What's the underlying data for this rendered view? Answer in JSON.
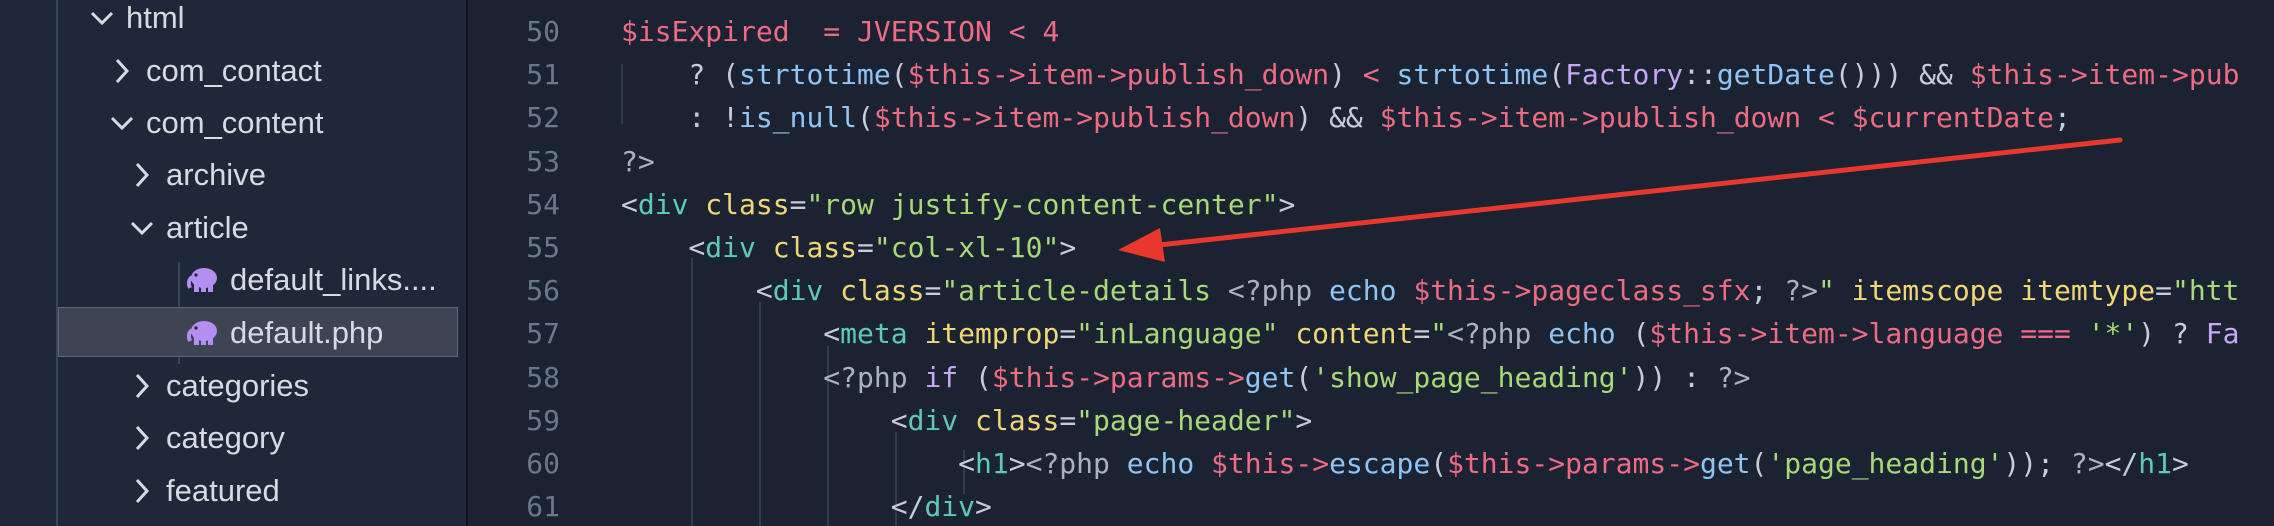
{
  "explorer": {
    "items": [
      {
        "label": "html",
        "state": "expanded",
        "type": "folder"
      },
      {
        "label": "com_contact",
        "state": "collapsed",
        "type": "folder"
      },
      {
        "label": "com_content",
        "state": "expanded",
        "type": "folder"
      },
      {
        "label": "archive",
        "state": "collapsed",
        "type": "folder"
      },
      {
        "label": "article",
        "state": "expanded",
        "type": "folder"
      },
      {
        "label": "default_links....",
        "type": "php-file"
      },
      {
        "label": "default.php",
        "type": "php-file",
        "selected": true
      },
      {
        "label": "categories",
        "state": "collapsed",
        "type": "folder"
      },
      {
        "label": "category",
        "state": "collapsed",
        "type": "folder"
      },
      {
        "label": "featured",
        "state": "collapsed",
        "type": "folder"
      }
    ]
  },
  "editor": {
    "line_numbers": [
      "50",
      "51",
      "52",
      "53",
      "54",
      "55",
      "56",
      "57",
      "58",
      "59",
      "60",
      "61"
    ],
    "lines": [
      [
        [
          "t-var",
          "$isExpired"
        ],
        [
          "t-punc",
          "  "
        ],
        [
          "t-op",
          "="
        ],
        [
          "t-punc",
          " "
        ],
        [
          "t-const",
          "JVERSION"
        ],
        [
          "t-punc",
          " "
        ],
        [
          "t-op",
          "<"
        ],
        [
          "t-punc",
          " "
        ],
        [
          "t-num",
          "4"
        ]
      ],
      [
        [
          "t-punc",
          "    ? ("
        ],
        [
          "t-fn",
          "strtotime"
        ],
        [
          "t-punc",
          "("
        ],
        [
          "t-var",
          "$this"
        ],
        [
          "t-op",
          "->"
        ],
        [
          "t-var",
          "item"
        ],
        [
          "t-op",
          "->"
        ],
        [
          "t-var",
          "publish_down"
        ],
        [
          "t-punc",
          ") "
        ],
        [
          "t-op",
          "<"
        ],
        [
          "t-punc",
          " "
        ],
        [
          "t-fn",
          "strtotime"
        ],
        [
          "t-punc",
          "("
        ],
        [
          "t-class",
          "Factory"
        ],
        [
          "t-punc",
          "::"
        ],
        [
          "t-fn",
          "getDate"
        ],
        [
          "t-punc",
          "())) && "
        ],
        [
          "t-var",
          "$this"
        ],
        [
          "t-op",
          "->"
        ],
        [
          "t-var",
          "item"
        ],
        [
          "t-op",
          "->"
        ],
        [
          "t-var",
          "pub"
        ]
      ],
      [
        [
          "t-punc",
          "    : !"
        ],
        [
          "t-fn",
          "is_null"
        ],
        [
          "t-punc",
          "("
        ],
        [
          "t-var",
          "$this"
        ],
        [
          "t-op",
          "->"
        ],
        [
          "t-var",
          "item"
        ],
        [
          "t-op",
          "->"
        ],
        [
          "t-var",
          "publish_down"
        ],
        [
          "t-punc",
          ") && "
        ],
        [
          "t-var",
          "$this"
        ],
        [
          "t-op",
          "->"
        ],
        [
          "t-var",
          "item"
        ],
        [
          "t-op",
          "->"
        ],
        [
          "t-var",
          "publish_down"
        ],
        [
          "t-punc",
          " "
        ],
        [
          "t-op",
          "<"
        ],
        [
          "t-punc",
          " "
        ],
        [
          "t-var",
          "$currentDate"
        ],
        [
          "t-punc",
          ";"
        ]
      ],
      [
        [
          "t-php",
          "?>"
        ]
      ],
      [
        [
          "t-punc",
          "<"
        ],
        [
          "t-tag",
          "div"
        ],
        [
          "t-punc",
          " "
        ],
        [
          "t-attr",
          "class"
        ],
        [
          "t-punc",
          "="
        ],
        [
          "t-str",
          "\"row justify-content-center\""
        ],
        [
          "t-punc",
          ">"
        ]
      ],
      [
        [
          "t-punc",
          "    <"
        ],
        [
          "t-tag",
          "div"
        ],
        [
          "t-punc",
          " "
        ],
        [
          "t-attr",
          "class"
        ],
        [
          "t-punc",
          "="
        ],
        [
          "t-str",
          "\"col-xl-10\""
        ],
        [
          "t-punc",
          ">"
        ]
      ],
      [
        [
          "t-punc",
          "        <"
        ],
        [
          "t-tag",
          "div"
        ],
        [
          "t-punc",
          " "
        ],
        [
          "t-attr",
          "class"
        ],
        [
          "t-punc",
          "="
        ],
        [
          "t-str",
          "\"article-details "
        ],
        [
          "t-php",
          "<?php "
        ],
        [
          "t-echo",
          "echo"
        ],
        [
          "t-punc",
          " "
        ],
        [
          "t-var",
          "$this"
        ],
        [
          "t-op",
          "->"
        ],
        [
          "t-var",
          "pageclass_sfx"
        ],
        [
          "t-punc",
          "; "
        ],
        [
          "t-php",
          "?>"
        ],
        [
          "t-str",
          "\""
        ],
        [
          "t-punc",
          " "
        ],
        [
          "t-attr",
          "itemscope"
        ],
        [
          "t-punc",
          " "
        ],
        [
          "t-attr",
          "itemtype"
        ],
        [
          "t-punc",
          "="
        ],
        [
          "t-str",
          "\"htt"
        ]
      ],
      [
        [
          "t-punc",
          "            <"
        ],
        [
          "t-tag",
          "meta"
        ],
        [
          "t-punc",
          " "
        ],
        [
          "t-attr",
          "itemprop"
        ],
        [
          "t-punc",
          "="
        ],
        [
          "t-str",
          "\"inLanguage\""
        ],
        [
          "t-punc",
          " "
        ],
        [
          "t-attr",
          "content"
        ],
        [
          "t-punc",
          "="
        ],
        [
          "t-str",
          "\""
        ],
        [
          "t-php",
          "<?php "
        ],
        [
          "t-echo",
          "echo"
        ],
        [
          "t-punc",
          " ("
        ],
        [
          "t-var",
          "$this"
        ],
        [
          "t-op",
          "->"
        ],
        [
          "t-var",
          "item"
        ],
        [
          "t-op",
          "->"
        ],
        [
          "t-var",
          "language"
        ],
        [
          "t-punc",
          " "
        ],
        [
          "t-op",
          "==="
        ],
        [
          "t-punc",
          " "
        ],
        [
          "t-str",
          "'*'"
        ],
        [
          "t-punc",
          ") ? "
        ],
        [
          "t-class",
          "Fa"
        ]
      ],
      [
        [
          "t-punc",
          "            "
        ],
        [
          "t-php",
          "<?php "
        ],
        [
          "t-kw",
          "if"
        ],
        [
          "t-punc",
          " ("
        ],
        [
          "t-var",
          "$this"
        ],
        [
          "t-op",
          "->"
        ],
        [
          "t-var",
          "params"
        ],
        [
          "t-op",
          "->"
        ],
        [
          "t-fn",
          "get"
        ],
        [
          "t-punc",
          "("
        ],
        [
          "t-str",
          "'show_page_heading'"
        ],
        [
          "t-punc",
          ")) : "
        ],
        [
          "t-php",
          "?>"
        ]
      ],
      [
        [
          "t-punc",
          "                <"
        ],
        [
          "t-tag",
          "div"
        ],
        [
          "t-punc",
          " "
        ],
        [
          "t-attr",
          "class"
        ],
        [
          "t-punc",
          "="
        ],
        [
          "t-str",
          "\"page-header\""
        ],
        [
          "t-punc",
          ">"
        ]
      ],
      [
        [
          "t-punc",
          "                    <"
        ],
        [
          "t-tag",
          "h1"
        ],
        [
          "t-punc",
          ">"
        ],
        [
          "t-php",
          "<?php "
        ],
        [
          "t-echo",
          "echo"
        ],
        [
          "t-punc",
          " "
        ],
        [
          "t-var",
          "$this"
        ],
        [
          "t-op",
          "->"
        ],
        [
          "t-fn",
          "escape"
        ],
        [
          "t-punc",
          "("
        ],
        [
          "t-var",
          "$this"
        ],
        [
          "t-op",
          "->"
        ],
        [
          "t-var",
          "params"
        ],
        [
          "t-op",
          "->"
        ],
        [
          "t-fn",
          "get"
        ],
        [
          "t-punc",
          "("
        ],
        [
          "t-str",
          "'page_heading'"
        ],
        [
          "t-punc",
          "));"
        ],
        [
          "t-punc",
          " "
        ],
        [
          "t-php",
          "?>"
        ],
        [
          "t-punc",
          "</"
        ],
        [
          "t-tag",
          "h1"
        ],
        [
          "t-punc",
          ">"
        ]
      ],
      [
        [
          "t-punc",
          "                </"
        ],
        [
          "t-tag",
          "div"
        ],
        [
          "t-punc",
          ">"
        ]
      ]
    ]
  },
  "annotation": {
    "type": "arrow",
    "color": "#e8372c"
  },
  "colors": {
    "background": "#1b2332",
    "sidebar": "#1f2838",
    "selection": "#3d4555",
    "php_icon": "#b48ef0"
  }
}
